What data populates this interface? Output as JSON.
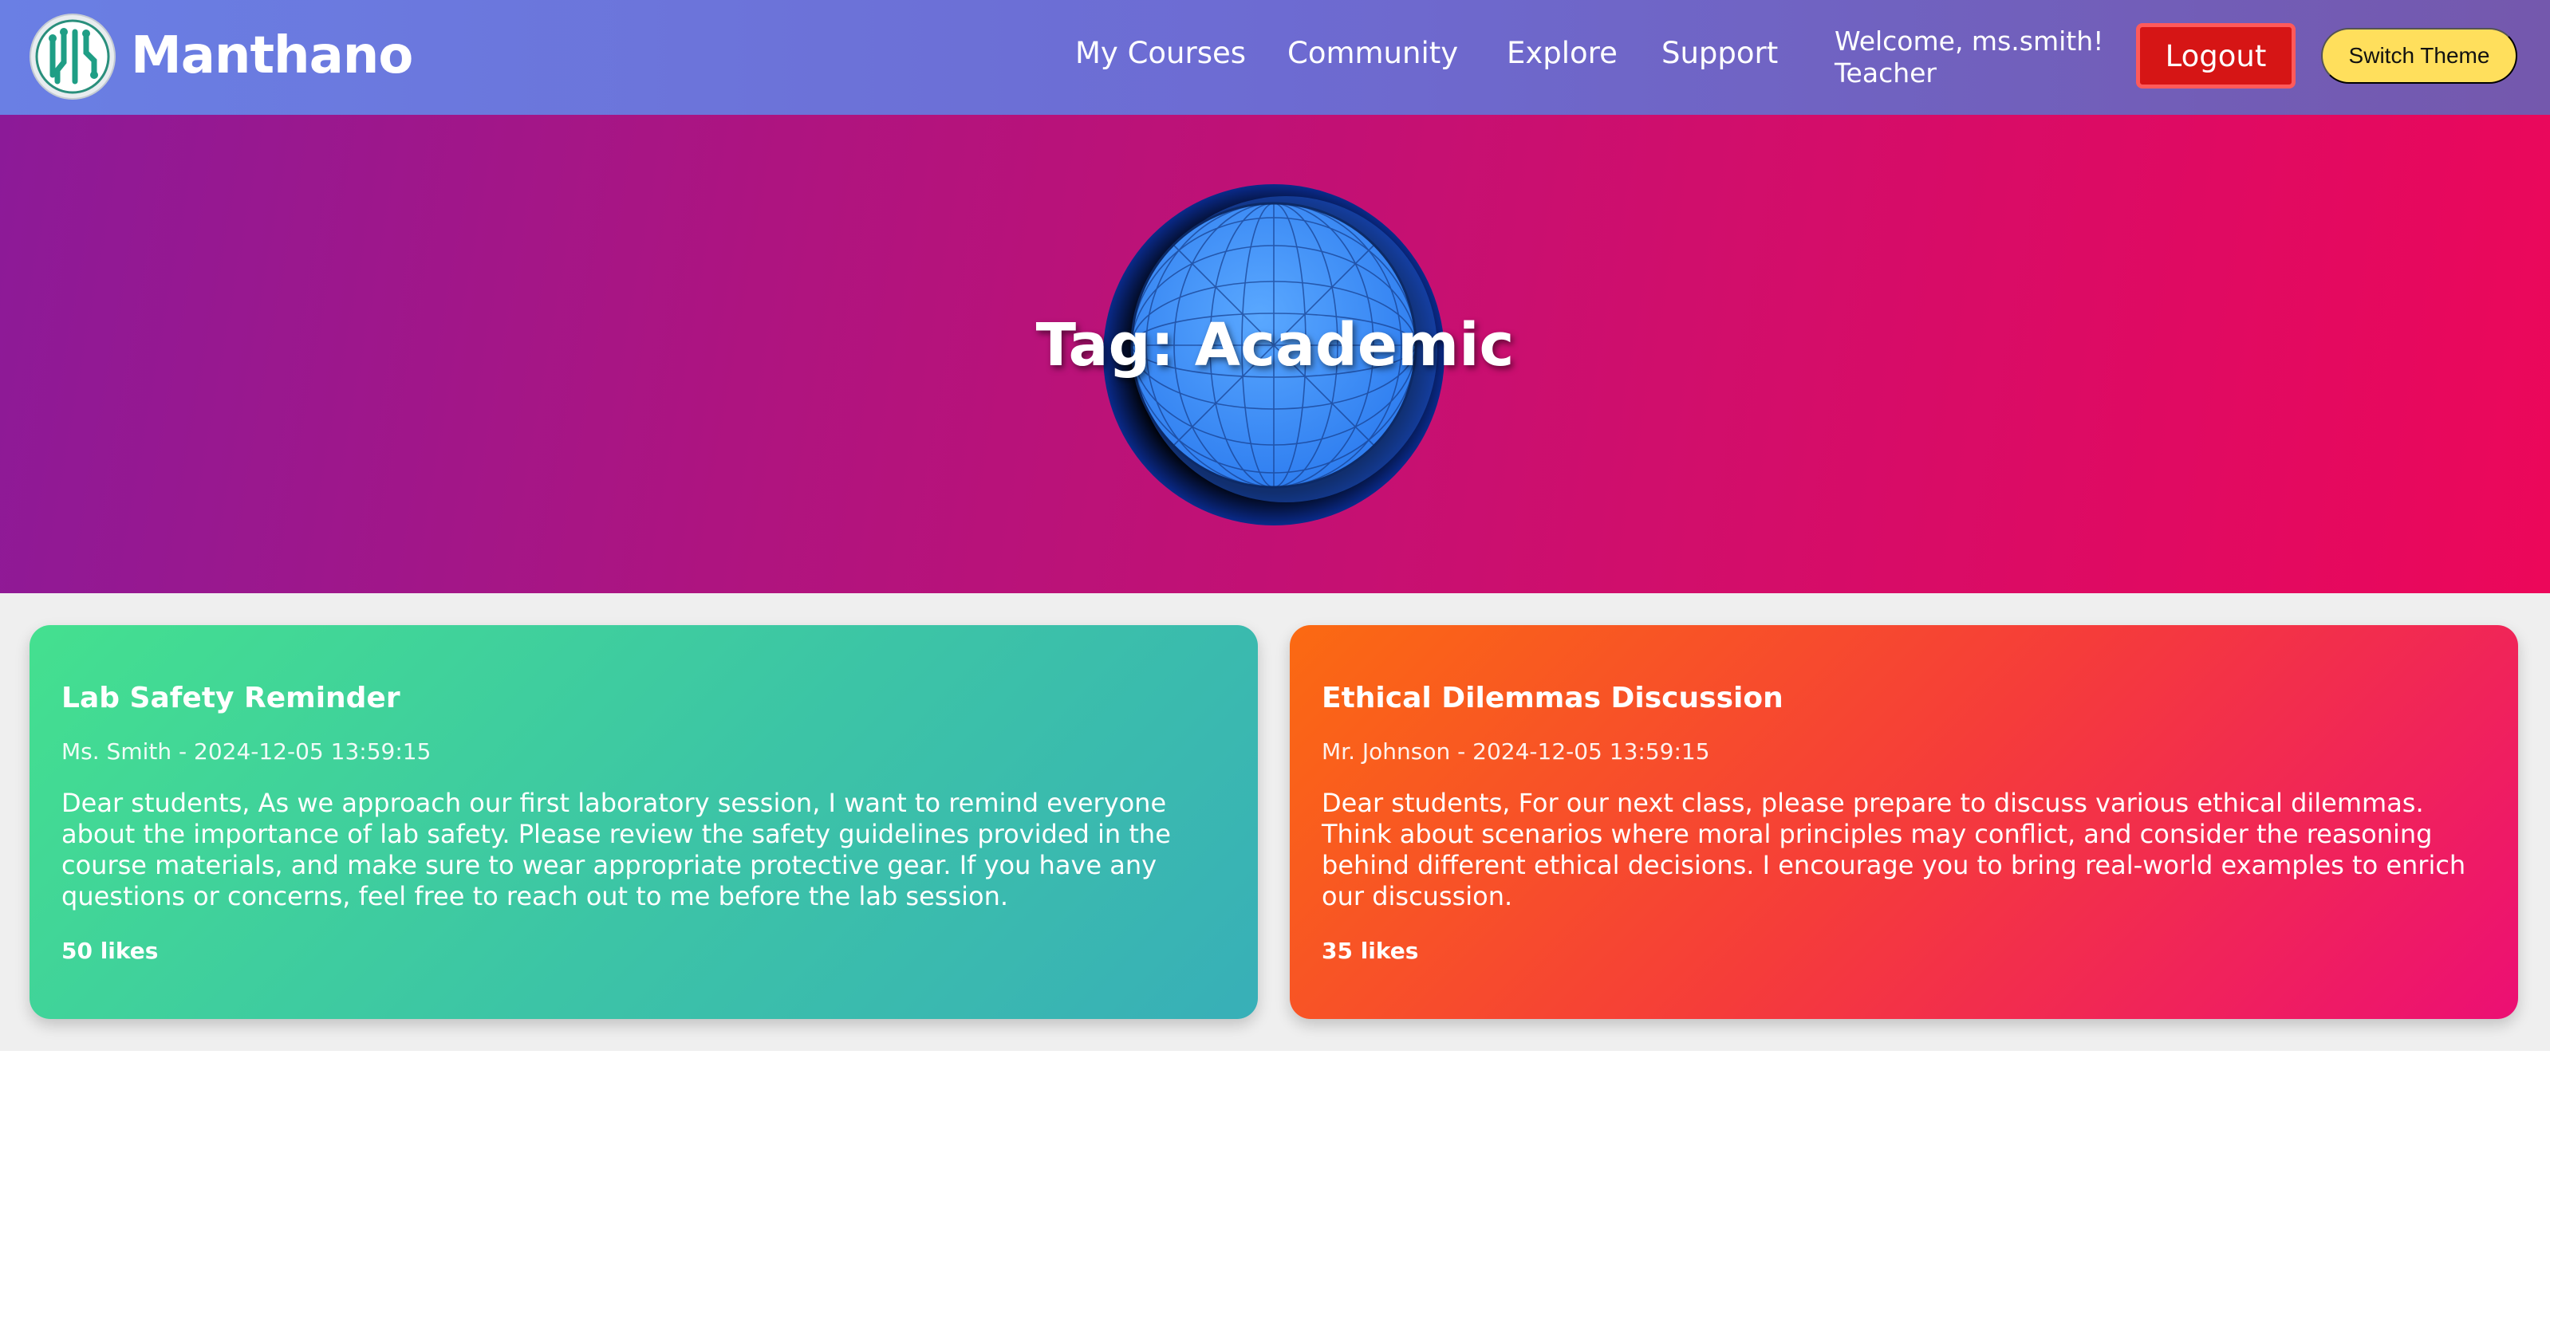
{
  "header": {
    "brand": "Manthano",
    "nav": [
      "My Courses",
      "Community",
      "Explore",
      "Support"
    ],
    "welcome_line1": "Welcome, ms.smith!",
    "welcome_line2": "Teacher",
    "logout_label": "Logout",
    "theme_label": "Switch Theme",
    "logo_icon": "circuit-brain-logo-icon"
  },
  "hero": {
    "title": "Tag: Academic",
    "image_icon": "wireframe-globe-icon"
  },
  "posts": [
    {
      "title": "Lab Safety Reminder",
      "meta": "Ms. Smith - 2024-12-05 13:59:15",
      "body": "Dear students, As we approach our first laboratory session, I want to remind everyone about the importance of lab safety. Please review the safety guidelines provided in the course materials, and make sure to wear appropriate protective gear. If you have any questions or concerns, feel free to reach out to me before the lab session.",
      "likes": "50 likes",
      "gradient": [
        "#44e08f",
        "#38afb8"
      ]
    },
    {
      "title": "Ethical Dilemmas Discussion",
      "meta": "Mr. Johnson - 2024-12-05 13:59:15",
      "body": "Dear students, For our next class, please prepare to discuss various ethical dilemmas. Think about scenarios where moral principles may conflict, and consider the reasoning behind different ethical decisions. I encourage you to bring real-world examples to enrich our discussion.",
      "likes": "35 likes",
      "gradient": [
        "#fb6a12",
        "#ec0f74"
      ]
    }
  ],
  "colors": {
    "header_start": "#6a7fe4",
    "header_end": "#7458ad",
    "hero_start": "#8c1a98",
    "hero_end": "#ec075a",
    "logout_bg": "#d61515",
    "theme_bg": "#ffdf5c",
    "posts_bg": "#efefef"
  }
}
